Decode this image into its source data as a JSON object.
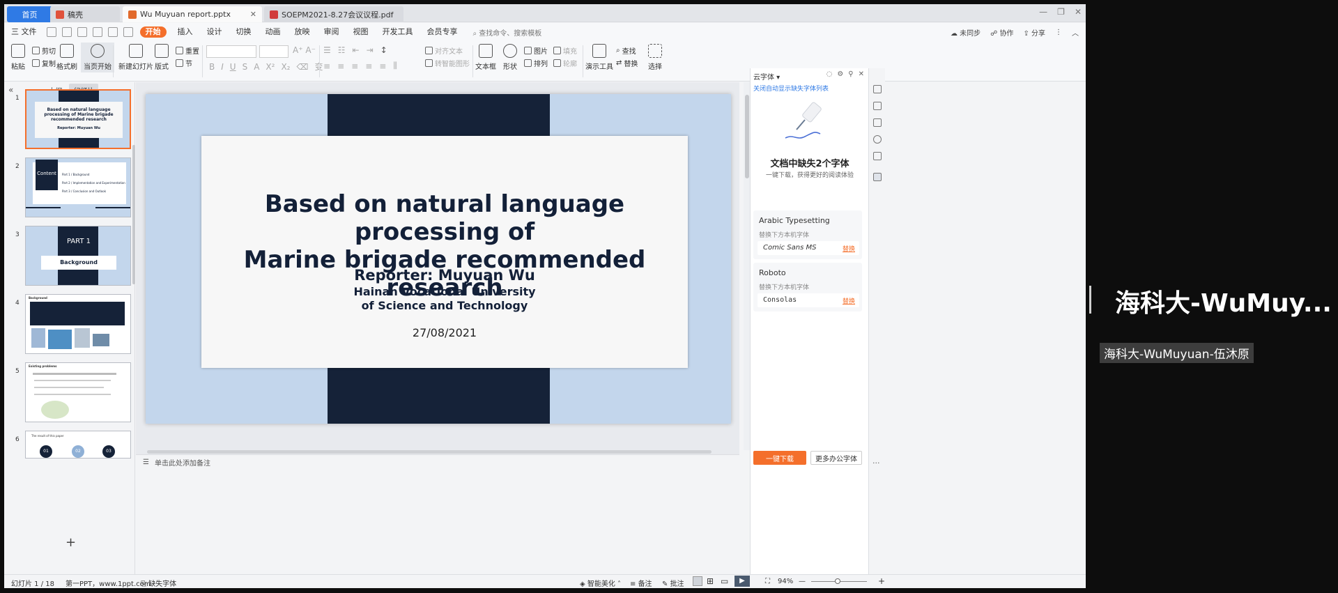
{
  "tabs": {
    "home": "首页",
    "draft": "稿壳",
    "pptx": "Wu Muyuan report.pptx",
    "pdf": "SOEPM2021-8.27会议议程.pdf"
  },
  "menu": {
    "file": "三 文件",
    "items": [
      "开始",
      "插入",
      "设计",
      "切换",
      "动画",
      "放映",
      "审阅",
      "视图",
      "开发工具",
      "会员专享"
    ],
    "search": "查找命令、搜索模板",
    "sync": "未同步",
    "collab": "协作",
    "share": "分享"
  },
  "ribbon": {
    "paste": "粘贴",
    "cut": "剪切",
    "copy": "复制",
    "format_painter": "格式刷",
    "start_show": "当页开始",
    "new_slide": "新建幻灯片",
    "layout": "版式",
    "section": "节",
    "reset": "重置",
    "align_text": "对齐文本",
    "smart_shape": "转智能图形",
    "textbox": "文本框",
    "shape": "形状",
    "picture": "图片",
    "arrange": "排列",
    "fill": "填充",
    "outline": "轮廓",
    "present_tool": "演示工具",
    "find": "查找",
    "replace": "替换",
    "select": "选择"
  },
  "left_panel": {
    "collapse": "«",
    "outline": "大纲",
    "slides": "幻灯片",
    "thumbs": [
      {
        "num": "1",
        "title": "Based on natural language processing of Marine brigade recommended research",
        "reporter": "Reporter: Muyuan Wu"
      },
      {
        "num": "2",
        "label": "Content",
        "items": [
          "Part 1 / Background",
          "Part 2 / Implementation and Experimentation",
          "Part 3 / Conclusion and Outlook"
        ]
      },
      {
        "num": "3",
        "part": "PART 1",
        "sub": "Background"
      },
      {
        "num": "4",
        "label": "Background"
      },
      {
        "num": "5",
        "label": "Existing problems"
      },
      {
        "num": "6",
        "label": "The result of this paper",
        "circles": [
          "01",
          "02",
          "03"
        ]
      }
    ]
  },
  "slide": {
    "title_line1": "Based on natural language processing of",
    "title_line2": "Marine brigade recommended research",
    "reporter": "Reporter:  Muyuan Wu",
    "univ_line1": "Hainan Vocational University",
    "univ_line2": "of Science and Technology",
    "date": "27/08/2021"
  },
  "notes": "单击此处添加备注",
  "right_panel": {
    "title": "云字体 ▾",
    "link": "关闭自动显示缺失字体列表",
    "heading": "文档中缺失2个字体",
    "sub": "一键下载，获得更好的阅读体验",
    "fonts": [
      {
        "name": "Arabic Typesetting",
        "hint": "替换下方本机字体",
        "replacement": "Comic Sans MS",
        "action": "替换"
      },
      {
        "name": "Roboto",
        "hint": "替换下方本机字体",
        "replacement": "Consolas",
        "action": "替换"
      }
    ],
    "download": "一键下载",
    "more": "更多办公字体"
  },
  "status": {
    "slide_index": "幻灯片 1 / 18",
    "theme": "第一PPT，www.1ppt.com",
    "missing_font": "缺失字体",
    "beautify": "智能美化",
    "notes": "备注",
    "comments": "批注",
    "zoom": "94%"
  },
  "video": {
    "name_big": "海科大-WuMuy...",
    "name_small": "海科大-WuMuyuan-伍沐原"
  },
  "colors": {
    "accent": "#f46f2b",
    "tab_active": "#2f7ae5",
    "slide_navy": "#152238",
    "slide_bg": "#c3d6ec"
  }
}
